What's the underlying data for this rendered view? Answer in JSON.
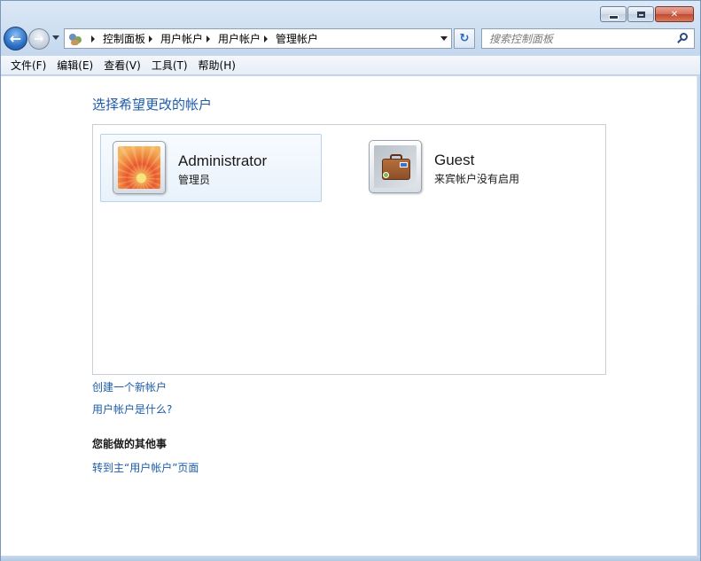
{
  "window": {
    "caption": {
      "minimize_glyph": "",
      "maximize_glyph": "",
      "close_glyph": "✕"
    }
  },
  "navbar": {
    "back_glyph": "←",
    "forward_glyph": "→",
    "breadcrumbs": [
      "控制面板",
      "用户帐户",
      "用户帐户",
      "管理帐户"
    ],
    "refresh_glyph": "↻",
    "search_placeholder": "搜索控制面板"
  },
  "menubar": {
    "items": [
      "文件(F)",
      "编辑(E)",
      "查看(V)",
      "工具(T)",
      "帮助(H)"
    ]
  },
  "content": {
    "heading": "选择希望更改的帐户",
    "accounts": [
      {
        "name": "Administrator",
        "role": "管理员",
        "selected": true
      },
      {
        "name": "Guest",
        "role": "来宾帐户没有启用",
        "selected": false
      }
    ],
    "links": {
      "create_account": "创建一个新帐户",
      "what_is_account": "用户帐户是什么?"
    },
    "other_tasks_heading": "您能做的其他事",
    "other_tasks_link": "转到主“用户帐户”页面"
  },
  "colors": {
    "link": "#1e5ca8",
    "heading": "#1e5ca8",
    "selected_bg": "#e8f2fb",
    "close_button": "#c04a30"
  }
}
